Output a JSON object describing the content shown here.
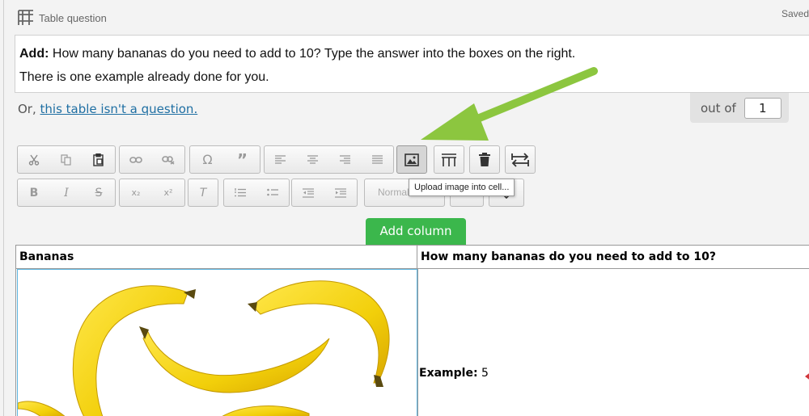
{
  "header": {
    "title": "Table question",
    "status": "Saved"
  },
  "question": {
    "bold_prefix": "Add:",
    "line1": " How many bananas do you need to add to 10? Type the answer into the boxes on the right.",
    "line2": "There is one example already done for you."
  },
  "not_question": {
    "prefix": "Or, ",
    "link": "this table isn't a question."
  },
  "marks": {
    "label": "out of",
    "value": "1"
  },
  "toolbar": {
    "format_select": "Normal",
    "tooltip": "Upload image into cell...",
    "icons": [
      "cut-icon",
      "copy-icon",
      "paste-icon",
      "link-icon",
      "unlink-icon",
      "omega-icon",
      "quote-icon",
      "align-left-icon",
      "align-center-icon",
      "align-right-icon",
      "justify-icon",
      "image-icon",
      "column-width-icon",
      "trash-icon",
      "swap-icon",
      "bold-icon",
      "italic-icon",
      "strikethrough-icon",
      "subscript-icon",
      "superscript-icon",
      "clear-format-icon",
      "numbered-list-icon",
      "bullet-list-icon",
      "outdent-icon",
      "indent-icon"
    ],
    "italic_glyph": "I",
    "bold_glyph": "B",
    "strike_glyph": "S",
    "sub_glyph": "x₂",
    "sup_glyph": "x²",
    "clear_glyph": "T",
    "omega_glyph": "Ω",
    "quote_glyph": "”"
  },
  "add_column": {
    "label": "Add column"
  },
  "table": {
    "headers": [
      "Bananas",
      "How many bananas do you need to add to 10?"
    ],
    "example_label": "Example:",
    "example_value": " 5"
  },
  "colors": {
    "accent_green": "#3bb74c",
    "arrow_green": "#8cc63f",
    "link_blue": "#1f6fa3",
    "banana_yellow": "#f2cf0a",
    "selected_cell_border": "#5fb6e0"
  }
}
